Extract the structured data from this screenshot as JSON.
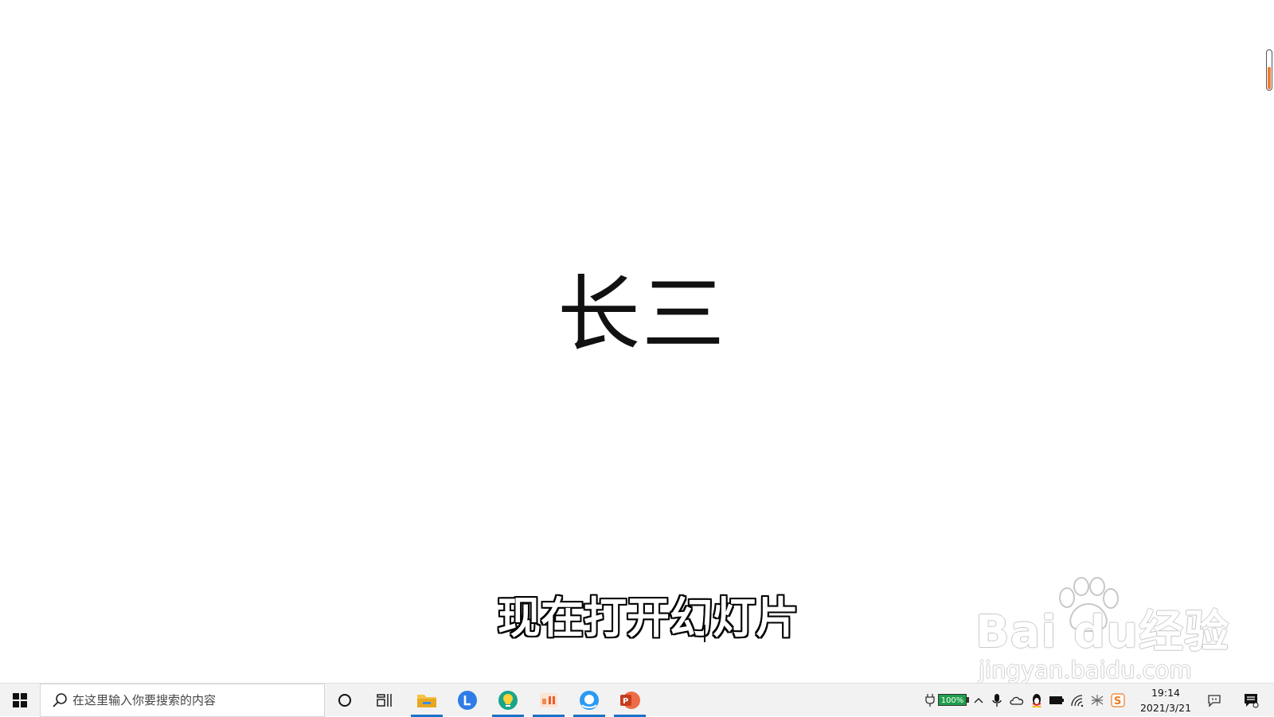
{
  "slide": {
    "title": "长三",
    "subtitle": "现在打开幻灯片"
  },
  "watermark": {
    "brand": "Bai du经验",
    "url": "jingyan.baidu.com"
  },
  "taskbar": {
    "search_placeholder": "在这里输入你要搜索的内容",
    "pinned_apps": [
      "file-explorer",
      "lens-app",
      "bulb-app",
      "slides-app",
      "browser-app",
      "powerpoint-app"
    ],
    "tray": {
      "battery_label": "100%",
      "time": "19:14",
      "date": "2021/3/21"
    }
  },
  "colors": {
    "accent": "#1a73c8",
    "battery": "#1e9e4a",
    "scroll_fill": "#f47c2a",
    "powerpoint": "#d24726"
  }
}
